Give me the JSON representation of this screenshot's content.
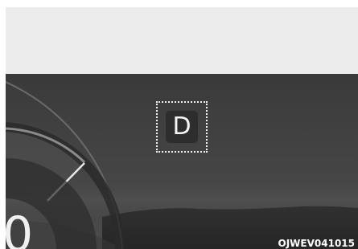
{
  "cluster": {
    "gear_indicator": "D",
    "speed_value": "0"
  },
  "image_code": "OJWEV041015",
  "colors": {
    "cluster_background": "#434343",
    "top_band": "#ececec",
    "gear_box": "#2d2d2d",
    "indicator_frame": "#f2f2f2",
    "text": "#f4f4f4"
  },
  "icons": [
    "gear-indicator",
    "speedometer-gauge"
  ]
}
